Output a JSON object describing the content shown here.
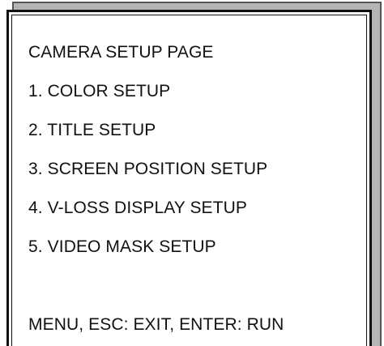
{
  "menu": {
    "title": "CAMERA SETUP PAGE",
    "items": [
      {
        "label": "1. COLOR SETUP"
      },
      {
        "label": "2. TITLE SETUP"
      },
      {
        "label": "3. SCREEN POSITION SETUP"
      },
      {
        "label": "4. V-LOSS DISPLAY SETUP"
      },
      {
        "label": "5. VIDEO MASK SETUP"
      }
    ],
    "footer": "MENU, ESC: EXIT, ENTER: RUN"
  },
  "colors": {
    "background": "#ffffff",
    "border": "#111111",
    "back_panel": "#b5b5b5"
  }
}
